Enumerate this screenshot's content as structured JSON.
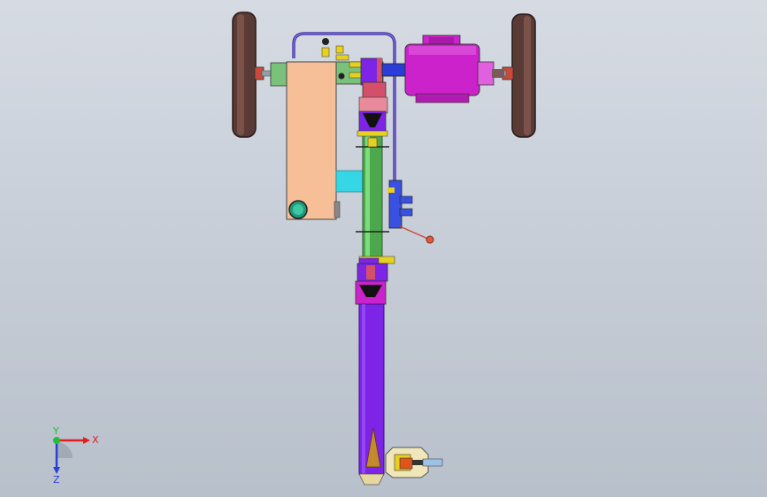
{
  "viewport": {
    "background_top": "#d6dbe3",
    "background_bottom": "#b8c0cb"
  },
  "triad": {
    "x_label": "X",
    "y_label": "Y",
    "z_label": "Z",
    "x_color": "#e11d1d",
    "y_color": "#1fbf3a",
    "z_color": "#2e3fd6"
  },
  "parts": {
    "wheel_color": "#5a3a35",
    "motor_color": "#cc22cc",
    "tank_color": "#f7bf98",
    "frame_green": "#7ac27a",
    "cylinder_green": "#4da84d",
    "arm_color": "#7d24e6",
    "blade_color": "#c58a2e",
    "hose_color": "#4b3aa8",
    "fitting_color": "#e8d020",
    "accent_red": "#d4506a",
    "cyan": "#35d6e6"
  }
}
